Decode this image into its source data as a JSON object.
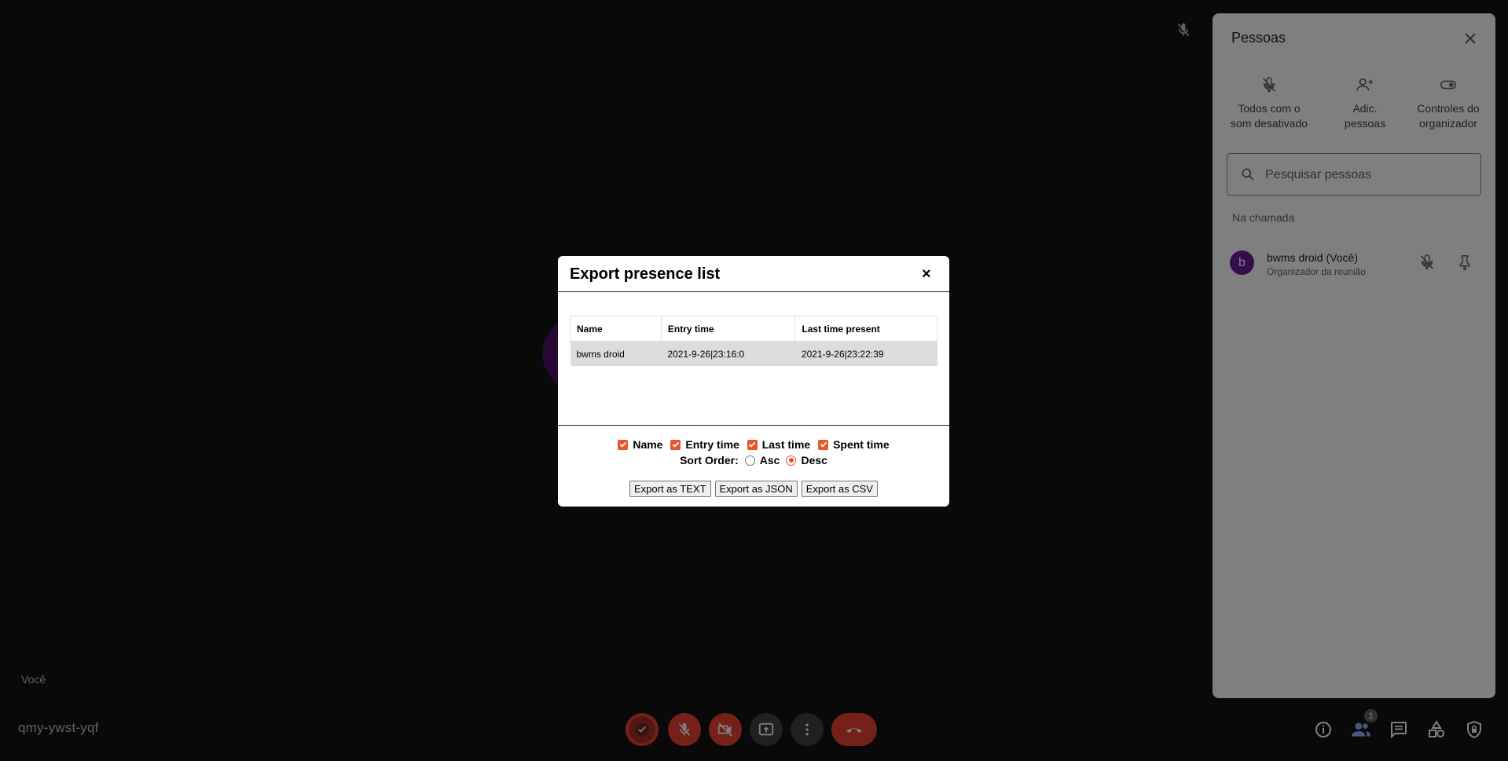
{
  "stage": {
    "you_label": "Você",
    "meeting_code": "qmy-ywst-yqf"
  },
  "controls": {
    "people_count": "1"
  },
  "people_panel": {
    "title": "Pessoas",
    "actions": [
      {
        "label_line1": "Todos com o",
        "label_line2": "som desativado"
      },
      {
        "label_line1": "Adic.",
        "label_line2": "pessoas"
      },
      {
        "label_line1": "Controles do",
        "label_line2": "organizador"
      }
    ],
    "search": {
      "placeholder": "Pesquisar pessoas",
      "value": ""
    },
    "section_label": "Na chamada",
    "participants": [
      {
        "avatar_letter": "b",
        "name": "bwms droid (Você)",
        "role": "Organizador da reunião"
      }
    ]
  },
  "dialog": {
    "title": "Export presence list",
    "close": "×",
    "table": {
      "headers": [
        "Name",
        "Entry time",
        "Last time present"
      ],
      "rows": [
        [
          "bwms droid",
          "2021-9-26|23:16:0",
          "2021-9-26|23:22:39"
        ]
      ]
    },
    "fields": [
      {
        "label": "Name",
        "checked": true
      },
      {
        "label": "Entry time",
        "checked": true
      },
      {
        "label": "Last time",
        "checked": true
      },
      {
        "label": "Spent time",
        "checked": true
      }
    ],
    "sort_label": "Sort Order:",
    "sort_options": [
      {
        "label": "Asc",
        "selected": false
      },
      {
        "label": "Desc",
        "selected": true
      }
    ],
    "buttons": [
      "Export as TEXT",
      "Export as JSON",
      "Export as CSV"
    ]
  },
  "colors": {
    "accent": "#e8562a",
    "danger": "#ea4335",
    "stage_bg": "#121214"
  }
}
